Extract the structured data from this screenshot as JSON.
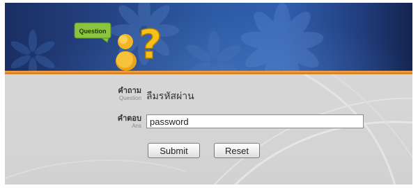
{
  "banner": {
    "badge_text": "Question",
    "mark_text": "?",
    "colors": {
      "background": "#23407f",
      "badge": "#8bc53f",
      "mark": "#f6c21a",
      "person": "#f2b620",
      "divider": "#e58a2b"
    }
  },
  "form": {
    "question": {
      "label_th": "คำถาม",
      "label_en": "Question",
      "value": "ลืมรหัสผ่าน"
    },
    "answer": {
      "label_th": "คำตอบ",
      "label_en": "Ans",
      "value": "password"
    },
    "submit_label": "Submit",
    "reset_label": "Reset"
  }
}
